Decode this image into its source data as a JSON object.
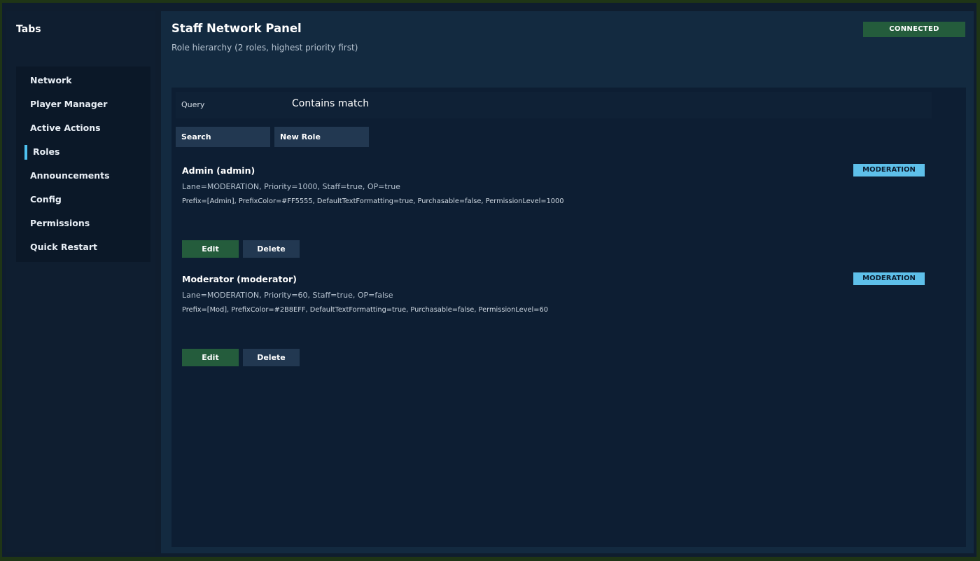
{
  "sidebar": {
    "title": "Tabs",
    "items": [
      {
        "label": "Network"
      },
      {
        "label": "Player Manager"
      },
      {
        "label": "Active Actions"
      },
      {
        "label": "Roles",
        "active": true
      },
      {
        "label": "Announcements"
      },
      {
        "label": "Config"
      },
      {
        "label": "Permissions"
      },
      {
        "label": "Quick Restart"
      }
    ]
  },
  "header": {
    "title": "Staff Network Panel",
    "subtitle": "Role hierarchy (2 roles, highest priority first)",
    "status": "CONNECTED"
  },
  "query": {
    "label": "Query",
    "value": "Contains match"
  },
  "toolbar": {
    "search_label": "Search",
    "new_role_label": "New Role"
  },
  "roles": [
    {
      "name": "Admin (admin)",
      "summary": "Lane=MODERATION, Priority=1000, Staff=true, OP=true",
      "details": "Prefix=[Admin], PrefixColor=#FF5555, DefaultTextFormatting=true, Purchasable=false, PermissionLevel=1000",
      "lane": "MODERATION",
      "edit_label": "Edit",
      "delete_label": "Delete"
    },
    {
      "name": "Moderator (moderator)",
      "summary": "Lane=MODERATION, Priority=60, Staff=true, OP=false",
      "details": "Prefix=[Mod], PrefixColor=#2B8EFF, DefaultTextFormatting=true, Purchasable=false, PermissionLevel=60",
      "lane": "MODERATION",
      "edit_label": "Edit",
      "delete_label": "Delete"
    }
  ],
  "colors": {
    "accent": "#4ec1f0",
    "success": "#245c3c",
    "lane_badge": "#5ec0ea",
    "background": "#0d1e33"
  }
}
